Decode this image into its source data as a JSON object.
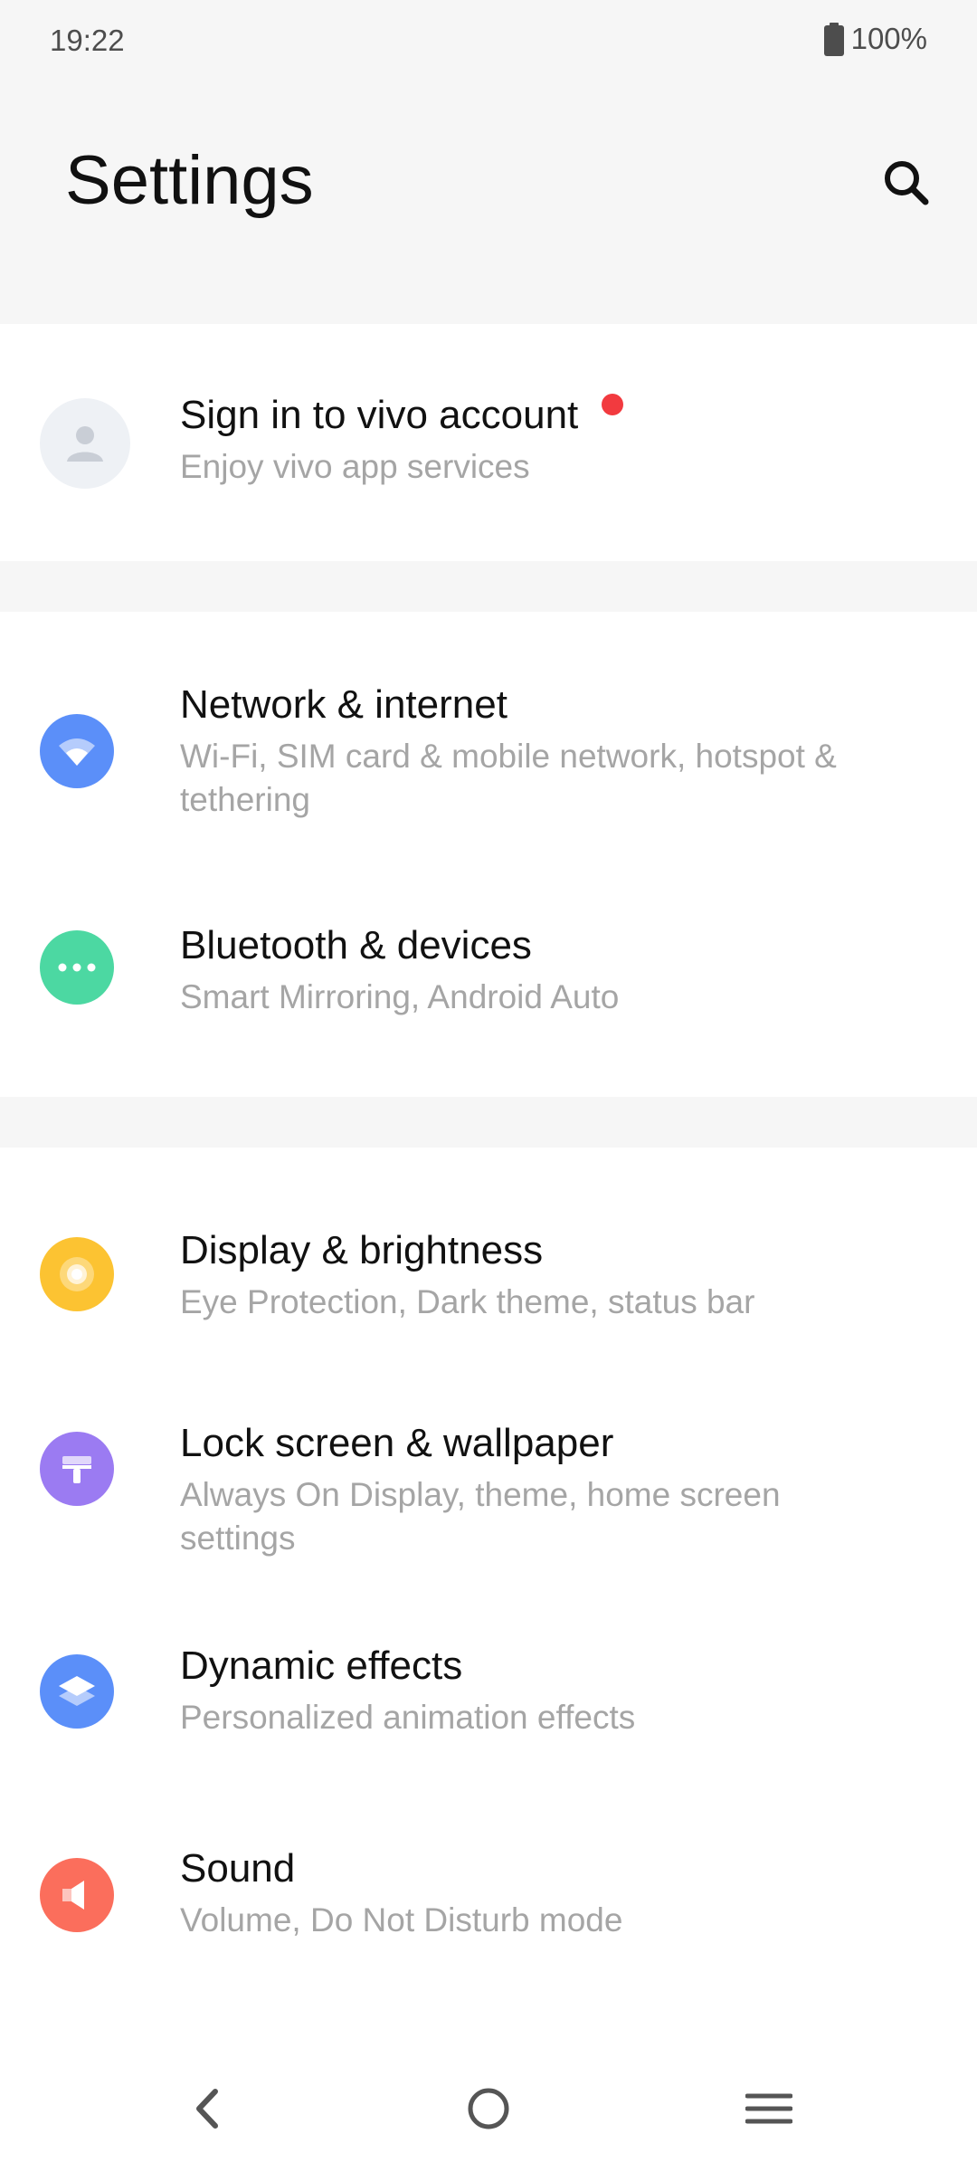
{
  "status_bar": {
    "time": "19:22",
    "battery": "100%",
    "battery_icon": "battery-full-icon"
  },
  "header": {
    "title": "Settings",
    "search_icon": "search-icon"
  },
  "account": {
    "title": "Sign in to vivo account",
    "subtitle": "Enjoy vivo app services",
    "icon": "avatar-icon",
    "has_notification": true
  },
  "settings_items": [
    {
      "title": "Network & internet",
      "subtitle": "Wi-Fi, SIM card & mobile network, hotspot & tethering",
      "icon": "wifi-icon",
      "color": "#5b8ff9"
    },
    {
      "title": "Bluetooth & devices",
      "subtitle": "Smart Mirroring, Android Auto",
      "icon": "more-dots-icon",
      "color": "#4cd8a2"
    },
    {
      "title": "Display & brightness",
      "subtitle": "Eye Protection, Dark theme, status bar",
      "icon": "brightness-icon",
      "color": "#fcc332"
    },
    {
      "title": "Lock screen & wallpaper",
      "subtitle": "Always On Display, theme, home screen settings",
      "icon": "paint-roller-icon",
      "color": "#9b7bf2"
    },
    {
      "title": "Dynamic effects",
      "subtitle": "Personalized animation effects",
      "icon": "layers-icon",
      "color": "#5b8ff9"
    },
    {
      "title": "Sound",
      "subtitle": "Volume, Do Not Disturb mode",
      "icon": "speaker-icon",
      "color": "#fb6e5c"
    }
  ],
  "nav_bar": {
    "back_icon": "back-icon",
    "home_icon": "home-icon",
    "recents_icon": "menu-icon"
  }
}
